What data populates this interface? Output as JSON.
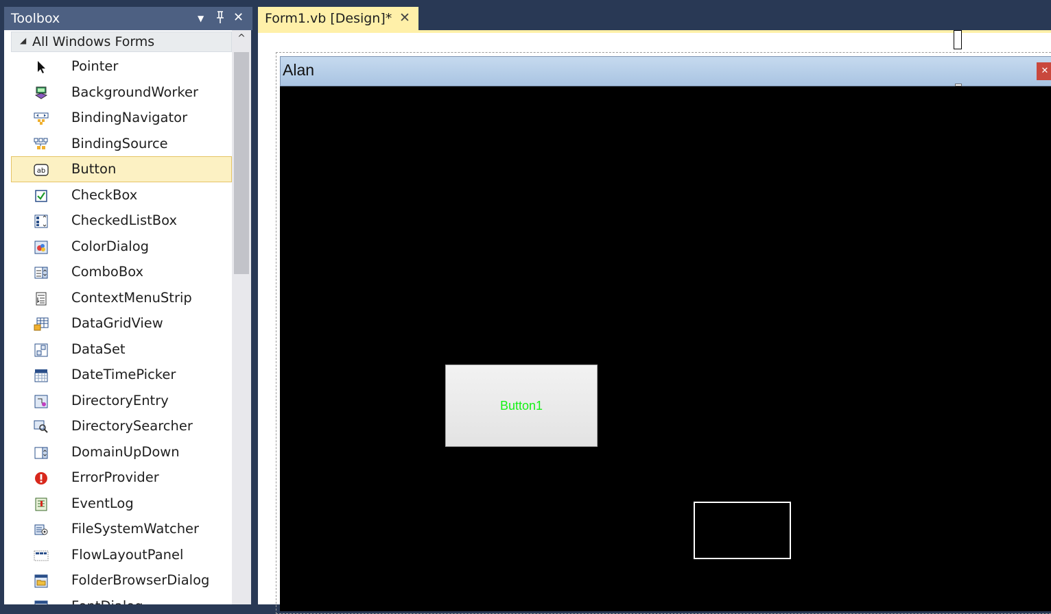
{
  "toolbox": {
    "title": "Toolbox",
    "controls": {
      "dropdown": "▼",
      "pin": "ᵜ",
      "close": "✕"
    },
    "category": {
      "arrow": "◢",
      "label": "All Windows Forms"
    },
    "items": [
      {
        "label": "Pointer",
        "icon": "pointer-icon"
      },
      {
        "label": "BackgroundWorker",
        "icon": "background-worker-icon"
      },
      {
        "label": "BindingNavigator",
        "icon": "binding-navigator-icon"
      },
      {
        "label": "BindingSource",
        "icon": "binding-source-icon"
      },
      {
        "label": "Button",
        "icon": "button-icon",
        "selected": true
      },
      {
        "label": "CheckBox",
        "icon": "checkbox-icon"
      },
      {
        "label": "CheckedListBox",
        "icon": "checked-list-box-icon"
      },
      {
        "label": "ColorDialog",
        "icon": "color-dialog-icon"
      },
      {
        "label": "ComboBox",
        "icon": "combobox-icon"
      },
      {
        "label": "ContextMenuStrip",
        "icon": "context-menu-strip-icon"
      },
      {
        "label": "DataGridView",
        "icon": "data-grid-view-icon"
      },
      {
        "label": "DataSet",
        "icon": "dataset-icon"
      },
      {
        "label": "DateTimePicker",
        "icon": "date-time-picker-icon"
      },
      {
        "label": "DirectoryEntry",
        "icon": "directory-entry-icon"
      },
      {
        "label": "DirectorySearcher",
        "icon": "directory-searcher-icon"
      },
      {
        "label": "DomainUpDown",
        "icon": "domain-up-down-icon"
      },
      {
        "label": "ErrorProvider",
        "icon": "error-provider-icon"
      },
      {
        "label": "EventLog",
        "icon": "event-log-icon"
      },
      {
        "label": "FileSystemWatcher",
        "icon": "file-system-watcher-icon"
      },
      {
        "label": "FlowLayoutPanel",
        "icon": "flow-layout-panel-icon"
      },
      {
        "label": "FolderBrowserDialog",
        "icon": "folder-browser-dialog-icon"
      },
      {
        "label": "FontDialog",
        "icon": "font-dialog-icon"
      }
    ],
    "scroll_up": "^"
  },
  "document_tab": {
    "label": "Form1.vb [Design]*",
    "close": "✕"
  },
  "form": {
    "title": "Alan",
    "close": "✕",
    "button1_label": "Button1"
  },
  "colors": {
    "chrome": "#293955",
    "tab_active": "#fff0a9",
    "selected_item": "#fcf1c3",
    "canvas": "#000000",
    "button_text": "#14f214"
  }
}
